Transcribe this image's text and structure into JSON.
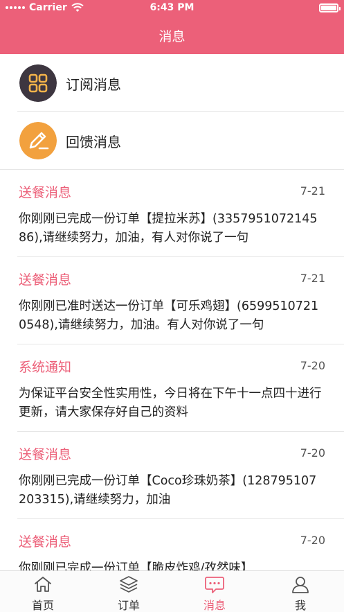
{
  "status": {
    "carrier": "Carrier",
    "time": "6:43 PM"
  },
  "header": {
    "title": "消息"
  },
  "menu": [
    {
      "label": "订阅消息",
      "icon": "grid-apps-icon"
    },
    {
      "label": "回馈消息",
      "icon": "edit-pencil-icon"
    }
  ],
  "messages": [
    {
      "title": "送餐消息",
      "date": "7-21",
      "body": "你刚刚已完成一份订单【提拉米苏】(335795107214586),请继续努力，加油，有人对你说了一句"
    },
    {
      "title": "送餐消息",
      "date": "7-21",
      "body": "你刚刚已准时送达一份订单【可乐鸡翅】(65995107210548),请继续努力，加油。有人对你说了一句"
    },
    {
      "title": "系统通知",
      "date": "7-20",
      "body": "为保证平台安全性实用性，今日将在下午十一点四十进行更新，请大家保存好自己的资料"
    },
    {
      "title": "送餐消息",
      "date": "7-20",
      "body": "你刚刚已完成一份订单【Coco珍珠奶茶】(128795107203315),请继续努力，加油"
    },
    {
      "title": "送餐消息",
      "date": "7-20",
      "body": "你刚刚已完成一份订单【脆皮炸鸡/孜然味】"
    }
  ],
  "tabs": [
    {
      "label": "首页",
      "icon": "home-icon"
    },
    {
      "label": "订单",
      "icon": "layers-icon"
    },
    {
      "label": "消息",
      "icon": "message-icon",
      "active": true
    },
    {
      "label": "我",
      "icon": "user-icon"
    }
  ],
  "colors": {
    "accent": "#ec6079",
    "subscribe_icon_bg": "#3d3640",
    "subscribe_icon_fg": "#f4b34a",
    "feedback_icon_bg": "#f2a13e"
  }
}
